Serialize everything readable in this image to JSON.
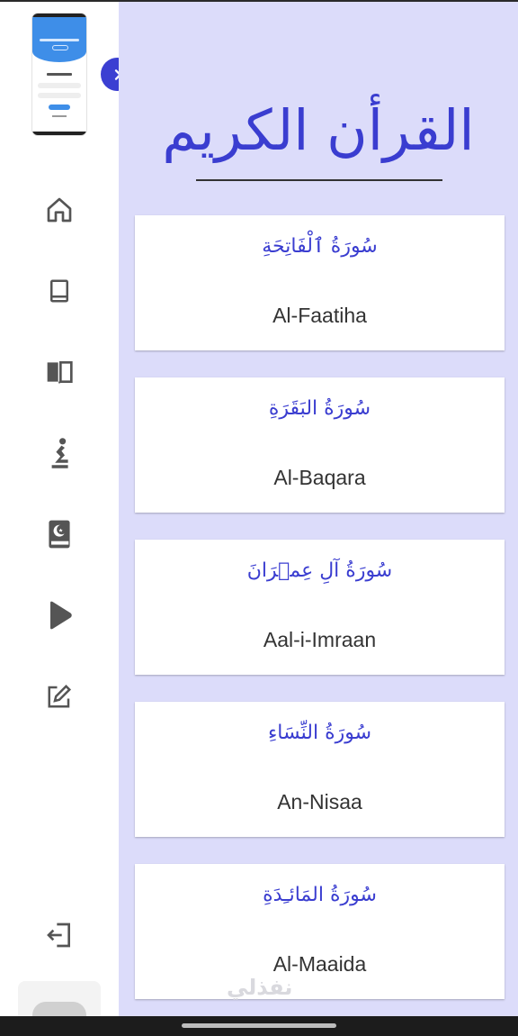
{
  "page": {
    "title": "القرأن الكريم",
    "accent_color": "#3a3dd0",
    "background_color": "#dcdcfa"
  },
  "sidebar": {
    "items": [
      {
        "icon": "home-icon"
      },
      {
        "icon": "book-icon"
      },
      {
        "icon": "open-book-icon"
      },
      {
        "icon": "praying-person-icon"
      },
      {
        "icon": "quran-book-icon"
      },
      {
        "icon": "play-icon"
      },
      {
        "icon": "edit-icon"
      }
    ],
    "logout_icon": "logout-icon",
    "collapse_icon": "chevron-right-icon"
  },
  "surahs": [
    {
      "arabic": "سُورَةُ ٱلْفَاتِحَةِ",
      "english": "Al-Faatiha"
    },
    {
      "arabic": "سُورَةُ البَقَرَةِ",
      "english": "Al-Baqara"
    },
    {
      "arabic": "سُورَةُ آلِ عِمۡرَانَ",
      "english": "Aal-i-Imraan"
    },
    {
      "arabic": "سُورَةُ النِّسَاءِ",
      "english": "An-Nisaa"
    },
    {
      "arabic": "سُورَةُ المَائـِدَةِ",
      "english": "Al-Maaida"
    }
  ],
  "watermark": "نفذلي"
}
